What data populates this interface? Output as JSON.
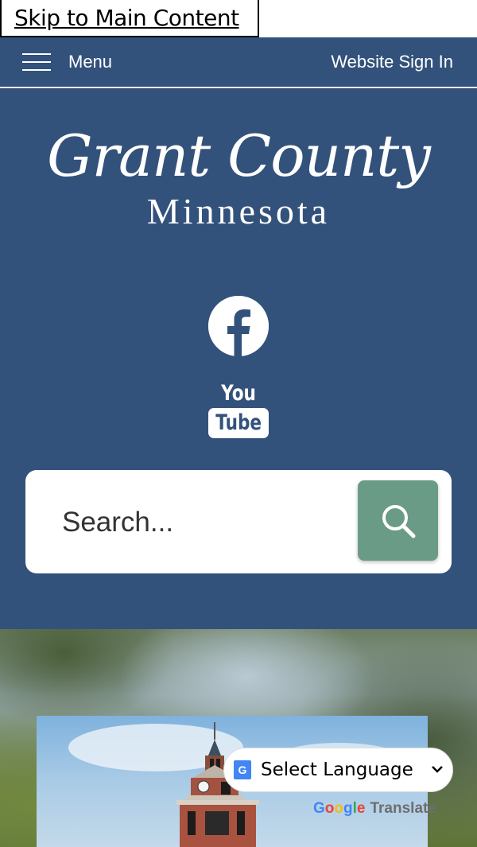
{
  "skip_link": "Skip to Main Content",
  "topbar": {
    "menu_label": "Menu",
    "signin_label": "Website Sign In"
  },
  "logo": {
    "line1": "Grant County",
    "line2": "Minnesota"
  },
  "social": {
    "facebook_icon": "facebook-icon",
    "youtube_you": "You",
    "youtube_tube": "Tube"
  },
  "search": {
    "placeholder": "Search...",
    "button_icon": "search-icon"
  },
  "translate": {
    "select_label": "Select Language",
    "google": [
      "G",
      "o",
      "o",
      "g",
      "l",
      "e"
    ],
    "translate_word": "Translate"
  },
  "colors": {
    "brand_blue": "#33527b",
    "search_button": "#6a9b87",
    "google_blue": "#4285f4",
    "google_red": "#ea4335",
    "google_yellow": "#fbbc05",
    "google_green": "#34a853"
  }
}
